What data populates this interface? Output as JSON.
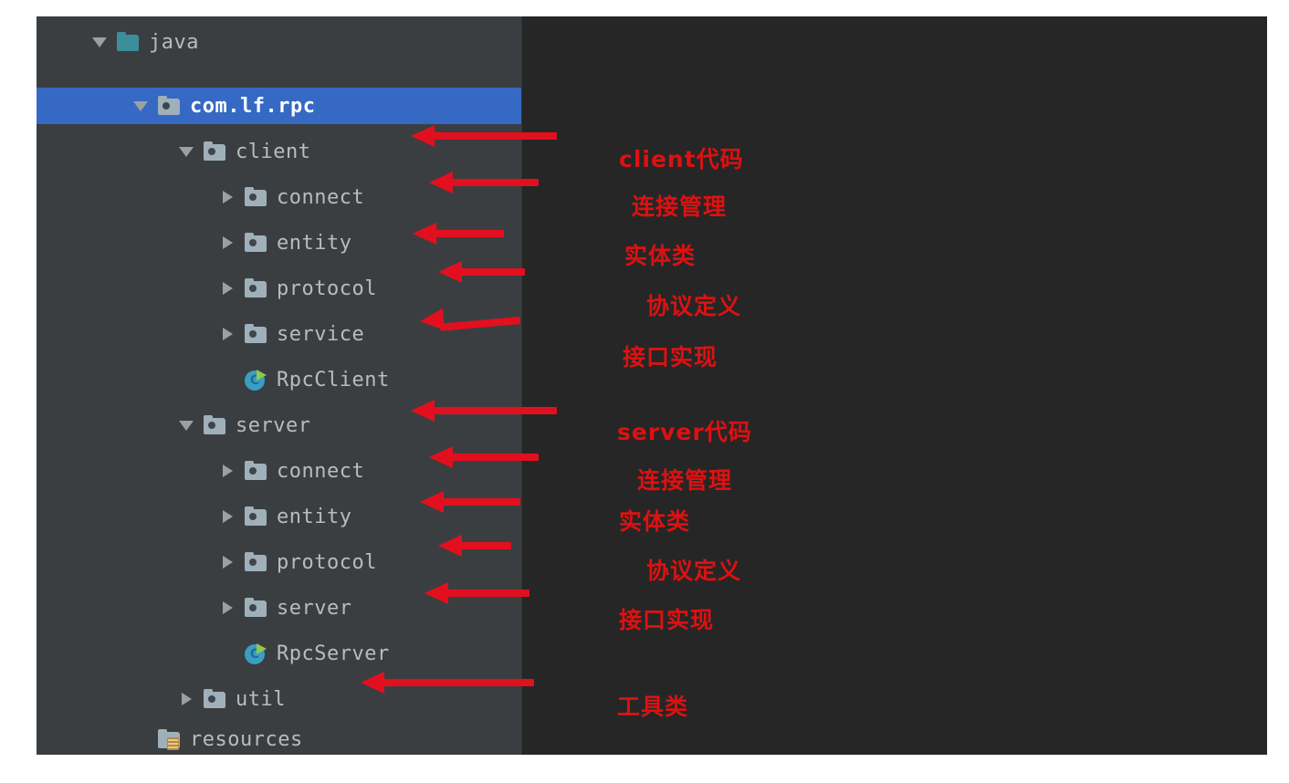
{
  "window": {
    "background": "#ffffff",
    "frame_background": "#262626",
    "tree_panel_background": "#3b3e40",
    "selection_color": "#3569c4",
    "annotation_color": "#dd1111",
    "arrow_color": "#e2101f"
  },
  "tree": {
    "rows": [
      {
        "label": "java",
        "indent": 0,
        "twisty": "open",
        "icon": "source-folder-icon",
        "selected": false
      },
      {
        "label": "com.lf.rpc",
        "indent": 1,
        "twisty": "open",
        "icon": "package-folder-icon",
        "selected": true
      },
      {
        "label": "client",
        "indent": 2,
        "twisty": "open",
        "icon": "package-folder-icon",
        "selected": false
      },
      {
        "label": "connect",
        "indent": 3,
        "twisty": "closed",
        "icon": "package-folder-icon",
        "selected": false
      },
      {
        "label": "entity",
        "indent": 3,
        "twisty": "closed",
        "icon": "package-folder-icon",
        "selected": false
      },
      {
        "label": "protocol",
        "indent": 3,
        "twisty": "closed",
        "icon": "package-folder-icon",
        "selected": false
      },
      {
        "label": "service",
        "indent": 3,
        "twisty": "closed",
        "icon": "package-folder-icon",
        "selected": false
      },
      {
        "label": "RpcClient",
        "indent": 3,
        "twisty": "none",
        "icon": "java-class-runnable-icon",
        "selected": false
      },
      {
        "label": "server",
        "indent": 2,
        "twisty": "open",
        "icon": "package-folder-icon",
        "selected": false
      },
      {
        "label": "connect",
        "indent": 3,
        "twisty": "closed",
        "icon": "package-folder-icon",
        "selected": false
      },
      {
        "label": "entity",
        "indent": 3,
        "twisty": "closed",
        "icon": "package-folder-icon",
        "selected": false
      },
      {
        "label": "protocol",
        "indent": 3,
        "twisty": "closed",
        "icon": "package-folder-icon",
        "selected": false
      },
      {
        "label": "server",
        "indent": 3,
        "twisty": "closed",
        "icon": "package-folder-icon",
        "selected": false
      },
      {
        "label": "RpcServer",
        "indent": 3,
        "twisty": "none",
        "icon": "java-class-runnable-icon",
        "selected": false
      },
      {
        "label": "util",
        "indent": 2,
        "twisty": "closed",
        "icon": "package-folder-icon",
        "selected": false
      },
      {
        "label": "resources",
        "indent": 1,
        "twisty": "none",
        "icon": "resource-folder-icon",
        "selected": false
      }
    ]
  },
  "annotations": [
    {
      "text": "client代码",
      "target": "client"
    },
    {
      "text": "连接管理",
      "target": "client.connect"
    },
    {
      "text": "实体类",
      "target": "client.entity"
    },
    {
      "text": "协议定义",
      "target": "client.protocol"
    },
    {
      "text": "接口实现",
      "target": "client.service"
    },
    {
      "text": "server代码",
      "target": "server"
    },
    {
      "text": "连接管理",
      "target": "server.connect"
    },
    {
      "text": "实体类",
      "target": "server.entity"
    },
    {
      "text": "协议定义",
      "target": "server.protocol"
    },
    {
      "text": "接口实现",
      "target": "server.server"
    },
    {
      "text": "工具类",
      "target": "util"
    }
  ]
}
